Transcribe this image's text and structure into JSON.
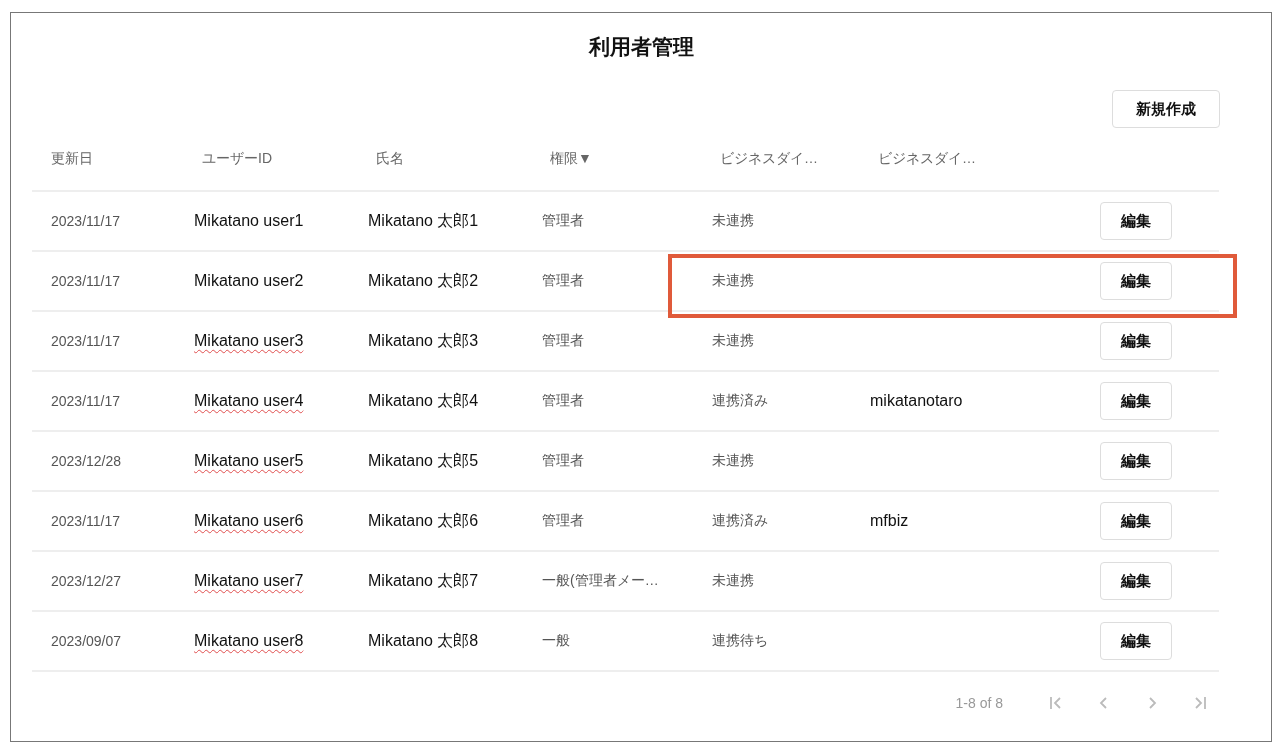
{
  "title": "利用者管理",
  "create_button": "新規作成",
  "table": {
    "columns": [
      {
        "label": "更新日"
      },
      {
        "label": "ユーザーID"
      },
      {
        "label": "氏名"
      },
      {
        "label": "権限▼"
      },
      {
        "label": "ビジネスダイ…"
      },
      {
        "label": "ビジネスダイ…"
      }
    ],
    "rows": [
      {
        "date": "2023/11/17",
        "user_id": "Mikatano user1",
        "name": "Mikatano 太郎1",
        "role": "管理者",
        "status": "未連携",
        "account": "",
        "action": "編集",
        "spell_flag": false,
        "highlighted": false
      },
      {
        "date": "2023/11/17",
        "user_id": "Mikatano user2",
        "name": "Mikatano 太郎2",
        "role": "管理者",
        "status": "未連携",
        "account": "",
        "action": "編集",
        "spell_flag": false,
        "highlighted": true
      },
      {
        "date": "2023/11/17",
        "user_id": "Mikatano user3",
        "name": "Mikatano 太郎3",
        "role": "管理者",
        "status": "未連携",
        "account": "",
        "action": "編集",
        "spell_flag": true,
        "highlighted": false
      },
      {
        "date": "2023/11/17",
        "user_id": "Mikatano user4",
        "name": "Mikatano 太郎4",
        "role": "管理者",
        "status": "連携済み",
        "account": "mikatanotaro",
        "action": "編集",
        "spell_flag": true,
        "highlighted": false
      },
      {
        "date": "2023/12/28",
        "user_id": "Mikatano user5",
        "name": "Mikatano 太郎5",
        "role": "管理者",
        "status": "未連携",
        "account": "",
        "action": "編集",
        "spell_flag": true,
        "highlighted": false
      },
      {
        "date": "2023/11/17",
        "user_id": "Mikatano user6",
        "name": "Mikatano 太郎6",
        "role": "管理者",
        "status": "連携済み",
        "account": "mfbiz",
        "action": "編集",
        "spell_flag": true,
        "highlighted": false
      },
      {
        "date": "2023/12/27",
        "user_id": "Mikatano user7",
        "name": "Mikatano 太郎7",
        "role": "一般(管理者メー…",
        "status": "未連携",
        "account": "",
        "action": "編集",
        "spell_flag": true,
        "highlighted": false
      },
      {
        "date": "2023/09/07",
        "user_id": "Mikatano user8",
        "name": "Mikatano 太郎8",
        "role": "一般",
        "status": "連携待ち",
        "account": "",
        "action": "編集",
        "spell_flag": true,
        "highlighted": false
      }
    ]
  },
  "pagination": {
    "range": "1-8 of 8"
  }
}
